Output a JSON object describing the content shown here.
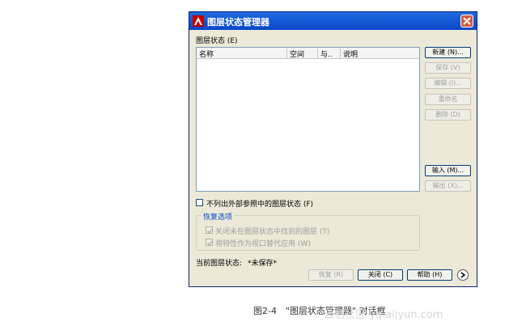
{
  "dialog": {
    "title": "图层状态管理器",
    "states_label": "图层状态 (E)",
    "columns": [
      "名称",
      "空间",
      "与..",
      "说明"
    ],
    "buttons": {
      "new": "新建 (N)...",
      "save": "保存 (V)",
      "edit": "编辑 (I)...",
      "rename": "重命名",
      "delete": "删除 (D)",
      "import": "输入 (M)...",
      "export": "输出 (X)..."
    },
    "exclude_xref_label": "不列出外部参照中的图层状态 (F)",
    "restore_group": {
      "title": "恢复选项",
      "option1": "关闭未在图层状态中找到的图层 (T)",
      "option2": "将特性作为视口替代应用 (W)"
    },
    "current_state_label": "当前图层状态:",
    "current_state_value": "*未保存*",
    "footer_buttons": {
      "restore": "恢复 (R)",
      "close": "关闭 (C)",
      "help": "帮助 (H)"
    }
  },
  "caption": "图2-4　\"图层状态管理器\" 对话框",
  "watermark": "云栖社区 yq.aliyun.com"
}
